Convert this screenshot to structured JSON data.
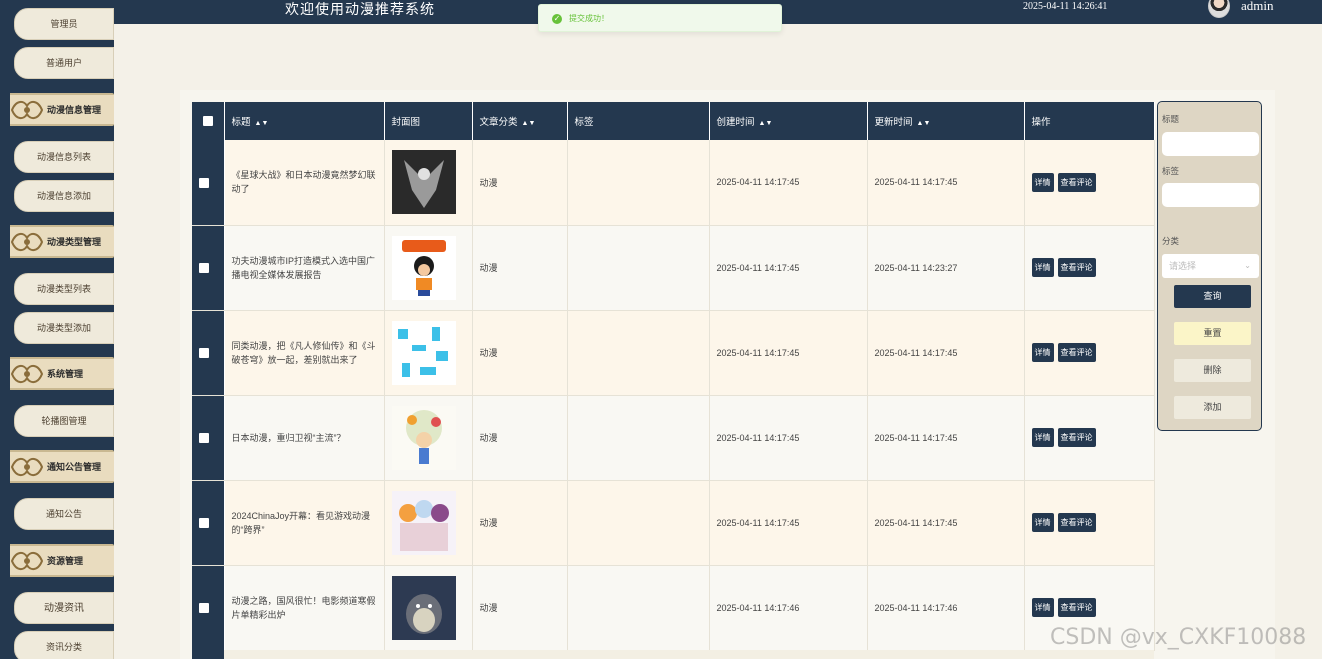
{
  "header": {
    "title": "欢迎使用动漫推荐系统",
    "datetime": "2025-04-11 14:26:41",
    "username": "admin"
  },
  "toast": {
    "message": "提交成功！",
    "icon": "check-circle-icon",
    "color": "#67c23a"
  },
  "sidebar": {
    "items": [
      {
        "label": "管理员",
        "kind": "item"
      },
      {
        "label": "普通用户",
        "kind": "item"
      },
      {
        "label": "动漫信息管理",
        "kind": "group"
      },
      {
        "label": "动漫信息列表",
        "kind": "item"
      },
      {
        "label": "动漫信息添加",
        "kind": "item"
      },
      {
        "label": "动漫类型管理",
        "kind": "group"
      },
      {
        "label": "动漫类型列表",
        "kind": "item"
      },
      {
        "label": "动漫类型添加",
        "kind": "item"
      },
      {
        "label": "系统管理",
        "kind": "group"
      },
      {
        "label": "轮播图管理",
        "kind": "item"
      },
      {
        "label": "通知公告管理",
        "kind": "group"
      },
      {
        "label": "通知公告",
        "kind": "item"
      },
      {
        "label": "资源管理",
        "kind": "group"
      },
      {
        "label": "动漫资讯",
        "kind": "item"
      },
      {
        "label": "资讯分类",
        "kind": "item"
      }
    ]
  },
  "table": {
    "columns": [
      "标题",
      "封面图",
      "文章分类",
      "标签",
      "创建时间",
      "更新时间",
      "操作"
    ],
    "sortable": [
      true,
      false,
      true,
      false,
      true,
      true,
      false
    ],
    "actions": {
      "detail": "详情",
      "comments": "查看评论"
    },
    "rows": [
      {
        "title": "《星球大战》和日本动漫竟然梦幻联动了",
        "category": "动漫",
        "tags": "",
        "created": "2025-04-11 14:17:45",
        "updated": "2025-04-11 14:17:45",
        "cover": "dark-angel"
      },
      {
        "title": "功夫动漫城市IP打造模式入选中国广播电视全媒体发展报告",
        "category": "动漫",
        "tags": "",
        "created": "2025-04-11 14:17:45",
        "updated": "2025-04-11 14:23:27",
        "cover": "goku"
      },
      {
        "title": "同类动漫，把《凡人修仙传》和《斗破苍穹》放一起，差别就出来了",
        "category": "动漫",
        "tags": "",
        "created": "2025-04-11 14:17:45",
        "updated": "2025-04-11 14:17:45",
        "cover": "qr-blocks"
      },
      {
        "title": "日本动漫，重归卫视“主流”？",
        "category": "动漫",
        "tags": "",
        "created": "2025-04-11 14:17:45",
        "updated": "2025-04-11 14:17:45",
        "cover": "cartoon-tree"
      },
      {
        "title": "2024ChinaJoy开幕：看见游戏动漫的“跨界”",
        "category": "动漫",
        "tags": "",
        "created": "2025-04-11 14:17:45",
        "updated": "2025-04-11 14:17:45",
        "cover": "anime-girls"
      },
      {
        "title": "动漫之路，国风很忙！电影频道寒假片单精彩出炉",
        "category": "动漫",
        "tags": "",
        "created": "2025-04-11 14:17:46",
        "updated": "2025-04-11 14:17:46",
        "cover": "totoro"
      }
    ]
  },
  "filter": {
    "title_label": "标题",
    "tags_label": "标签",
    "category_label": "分类",
    "category_placeholder": "请选择",
    "buttons": {
      "search": "查询",
      "reset": "重置",
      "delete": "删除",
      "add": "添加"
    }
  },
  "watermark": "CSDN @vx_CXKF10088",
  "colors": {
    "navy": "#24384f",
    "cream": "#efeadb",
    "reset": "#fbf5c8",
    "neutral": "#eeeadd"
  }
}
